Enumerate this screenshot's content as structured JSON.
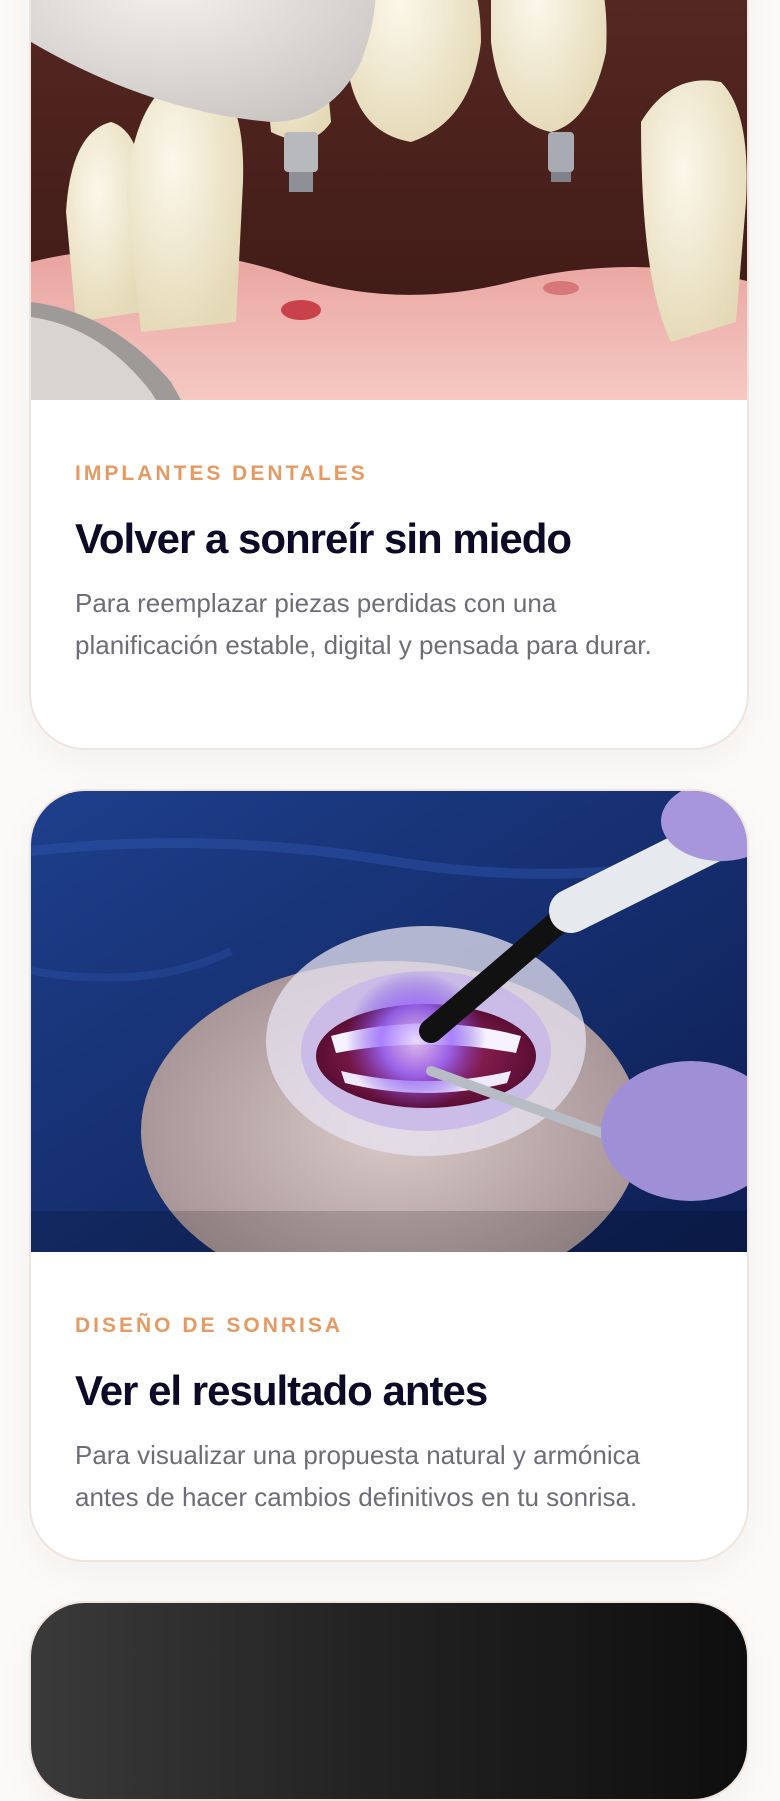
{
  "cards": [
    {
      "tag": "IMPLANTES DENTALES",
      "title": "Volver a sonreír sin miedo",
      "description": "Para reemplazar piezas perdidas con una planificación estable, digital y pensada para durar.",
      "image": "dental-implant-photo"
    },
    {
      "tag": "DISEÑO DE SONRISA",
      "title": "Ver el resultado antes",
      "description": "Para visualizar una propuesta natural y armónica antes de hacer cambios definitivos en tu sonrisa.",
      "image": "smile-design-photo"
    },
    {
      "tag": "",
      "title": "",
      "description": "",
      "image": "dark-photo"
    }
  ],
  "colors": {
    "accent": "#e59a63",
    "heading": "#0c0a26",
    "body_text": "#6f6c77",
    "card_border": "#f0e4dc"
  }
}
